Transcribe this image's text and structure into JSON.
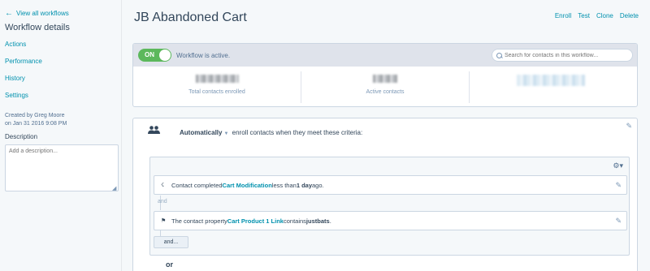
{
  "sidebar": {
    "back_link": "View all workflows",
    "title": "Workflow details",
    "links": [
      "Actions",
      "Performance",
      "History",
      "Settings"
    ],
    "created_by": "Created by Greg Moore",
    "created_on": "on Jan 31 2016 9:08 PM",
    "description_label": "Description",
    "description_placeholder": "Add a description..."
  },
  "header": {
    "title": "JB Abandoned Cart",
    "actions": [
      "Enroll",
      "Test",
      "Clone",
      "Delete"
    ]
  },
  "summary": {
    "toggle_label": "ON",
    "status": "Workflow is active.",
    "search_placeholder": "Search for contacts in this workflow...",
    "stats": [
      {
        "label": "Total contacts enrolled"
      },
      {
        "label": "Active contacts"
      },
      {
        "label": ""
      }
    ]
  },
  "criteria": {
    "mode": "Automatically",
    "mode_rest": "enroll contacts when they meet these criteria:",
    "filters": [
      {
        "pre": "Contact completed ",
        "highlight": "Cart Modification",
        "mid": " less than ",
        "bold": "1 day",
        "post": " ago.",
        "icon": "lightning-icon"
      },
      {
        "pre": "The contact property ",
        "highlight": "Cart Product 1 Link",
        "mid": " contains ",
        "bold": "justbats",
        "post": ".",
        "icon": "flag-icon"
      }
    ],
    "and_connector": "and",
    "and_button": "and...",
    "or_label": "or"
  }
}
